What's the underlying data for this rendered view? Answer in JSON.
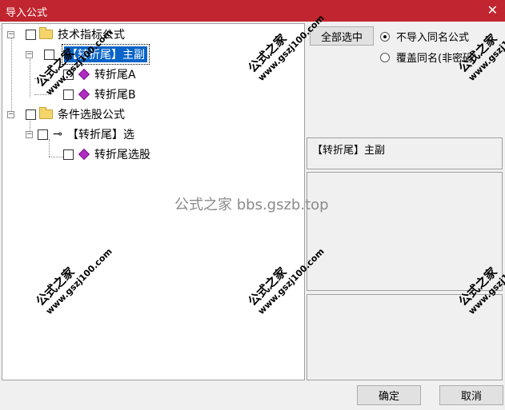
{
  "window": {
    "title": "导入公式",
    "close_glyph": "✕"
  },
  "tree": {
    "group1": {
      "label": "技术指标公式",
      "expander": "−"
    },
    "item_selected": {
      "label": "【转折尾】主副",
      "expander": "−"
    },
    "item_a": {
      "label": "转折尾A"
    },
    "item_b": {
      "label": "转折尾B"
    },
    "group2": {
      "label": "条件选股公式",
      "expander": "−"
    },
    "item_select": {
      "label": "【转折尾】选",
      "expander": "−",
      "icon_glyph": "⊸"
    },
    "item_select_stock": {
      "label": "转折尾选股"
    }
  },
  "options": {
    "select_all_label": "全部选中",
    "radio_skip_label": "不导入同名公式",
    "radio_overwrite_label": "覆盖同名(非密码)",
    "radio_selected": "skip"
  },
  "preview": {
    "name": "【转折尾】主副"
  },
  "buttons": {
    "ok": "确定",
    "cancel": "取消"
  },
  "watermarks": {
    "line1": "公式之家",
    "line2": "www.gszj100.com",
    "center": "公式之家 bbs.gszb.top"
  },
  "colors": {
    "titlebar": "#c1252f",
    "selection": "#0a64c8",
    "gem": "#b12bc3"
  }
}
